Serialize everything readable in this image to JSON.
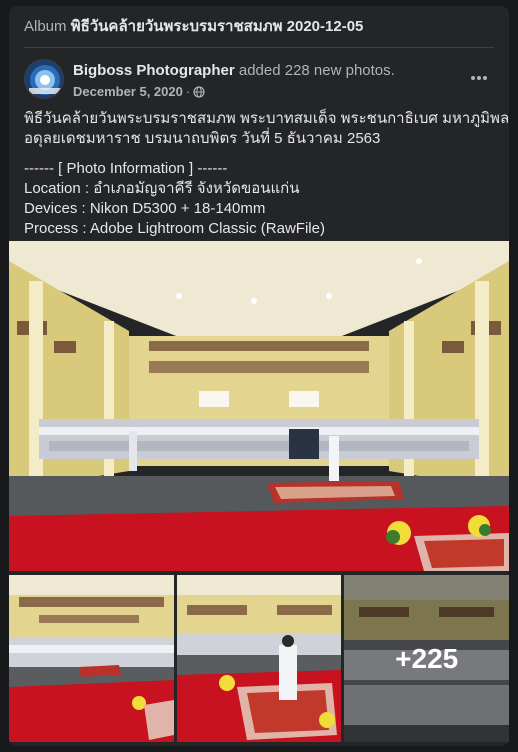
{
  "album": {
    "prefix": "Album",
    "title": "พิธีวันคล้ายวันพระบรมราชสมภพ 2020-12-05"
  },
  "post": {
    "author": "Bigboss Photographer",
    "action": "added 228 new photos.",
    "date": "December 5, 2020",
    "separator": "·",
    "audience_icon": "globe-icon",
    "more_icon": "more-horizontal-icon",
    "text_line_1": "พิธีวันคล้ายวันพระบรมราชสมภพ พระบาทสมเด็จ พระชนกาธิเบศ มหาภูมิพล",
    "text_line_2": "อดุลยเดชมหาราช บรมนาถบพิตร วันที่ 5 ธันวาคม 2563",
    "info_header": "------ [ Photo Information ] ------",
    "info_location": "Location : อำเภอมัญจาคีรี จังหวัดขอนแก่น",
    "info_devices": "Devices : Nikon D5300 + 18-140mm",
    "info_process": "Process : Adobe Lightroom Classic (RawFile)"
  },
  "gallery": {
    "more_count": "+225"
  },
  "colors": {
    "background": "#18191a",
    "card": "#242526",
    "primary_text": "#e4e6eb",
    "secondary_text": "#b0b3b8",
    "carpet_red": "#c8121f",
    "hall_yellow": "#e9dc9a"
  }
}
